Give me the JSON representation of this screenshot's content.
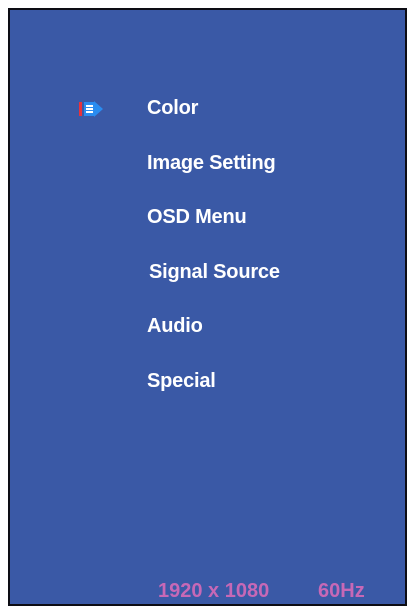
{
  "menu": {
    "items": [
      {
        "label": "Color",
        "selected": true
      },
      {
        "label": "Image  Setting",
        "selected": false
      },
      {
        "label": "OSD Menu",
        "selected": false
      },
      {
        "label": "Signal Source",
        "selected": false
      },
      {
        "label": "Audio",
        "selected": false
      },
      {
        "label": "Special",
        "selected": false
      }
    ],
    "cursor_icon": "selection-pointer-icon"
  },
  "status": {
    "resolution": "1920 x 1080",
    "refresh_rate": "60Hz"
  },
  "colors": {
    "background": "#3a59a6",
    "frame_border": "#0d0d14",
    "menu_text": "#ffffff",
    "status_text": "#c768b6",
    "cursor_red": "#e8323c",
    "cursor_blue": "#2a8cf0"
  }
}
